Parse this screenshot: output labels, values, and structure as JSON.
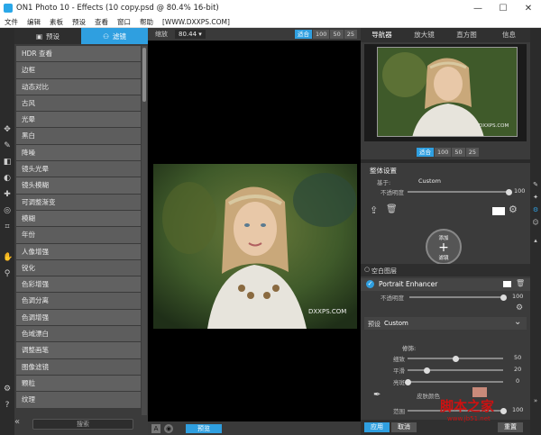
{
  "window": {
    "title": "ON1 Photo 10 - Effects (10 copy.psd @ 80.4% 16-bit)",
    "minimize": "—",
    "maximize": "☐",
    "close": "✕"
  },
  "menu": [
    "文件",
    "编辑",
    "素板",
    "预设",
    "查看",
    "窗口",
    "帮助",
    "[WWW.DXXPS.COM]"
  ],
  "left_panel": {
    "tabs": [
      {
        "label": "预设",
        "icon": "image-icon"
      },
      {
        "label": "滤镜",
        "icon": "filters-icon"
      }
    ],
    "filters": [
      "HDR 查看",
      "边框",
      "动态对比",
      "古风",
      "光晕",
      "黑白",
      "降噪",
      "镜头光晕",
      "镜头模糊",
      "可调整渐变",
      "模糊",
      "年份",
      "人像增强",
      "锐化",
      "色彩增强",
      "色调分离",
      "色调增强",
      "色域漂白",
      "调整画笔",
      "图像滤镜",
      "颗粒",
      "纹理"
    ],
    "search_placeholder": "搜索"
  },
  "canvas": {
    "zoom_label": "缩放",
    "zoom_value": "80.44",
    "zoom_buttons": [
      "适合",
      "100",
      "50",
      "25"
    ],
    "preview_label": "预览",
    "watermark": "DXXPS.COM"
  },
  "right_panel": {
    "tabs": [
      "导航器",
      "放大镜",
      "直方图",
      "信息"
    ],
    "nav_zoom_buttons": [
      "适合",
      "100",
      "50",
      "25"
    ],
    "nav_watermark": "DXXPS.COM",
    "overall_settings": {
      "title": "整体设置",
      "preset_label": "基于:",
      "preset_value": "Custom",
      "opacity_label": "不透明度",
      "opacity_value": "100",
      "opacity": 1.0
    },
    "add_filter_label": "添加\n滤镜",
    "layer": {
      "label": "空白图层"
    },
    "portrait": {
      "name": "Portrait Enhancer",
      "opacity_label": "不透明度",
      "opacity_value": "100",
      "opacity": 1.0,
      "preset_label": "预设",
      "preset_value": "Custom",
      "retouch_label": "修饰:",
      "sliders": [
        {
          "label": "细致",
          "value": "50",
          "level": 0.5
        },
        {
          "label": "平滑",
          "value": "20",
          "level": 0.2
        },
        {
          "label": "亮斑",
          "value": "0",
          "level": 0.0
        }
      ],
      "skin_color_label": "皮肤颜色",
      "skin_color": "#c98a7a",
      "range_label": "范围",
      "range_value": "100",
      "range_level": 1.0
    },
    "bottom_buttons": [
      "应用",
      "取消",
      "重置"
    ]
  },
  "colors": {
    "accent": "#2f9fe0"
  }
}
